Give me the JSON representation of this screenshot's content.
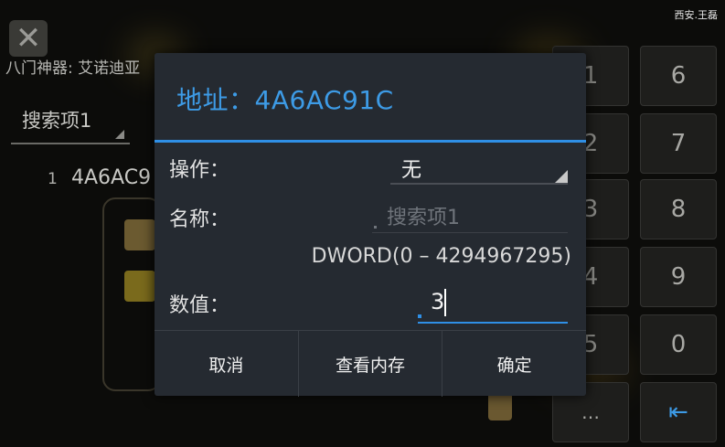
{
  "watermark": "西安.王磊",
  "background": {
    "app_title": "八门神器: 艾诺迪亚",
    "search_item_label": "搜索项1",
    "result_index": "1",
    "result_value": "4A6AC9",
    "keypad_keys": [
      "1",
      "6",
      "2",
      "7",
      "3",
      "8",
      "4",
      "9",
      "5",
      "0",
      "…",
      "⇤"
    ]
  },
  "dialog": {
    "title": "地址：4A6AC91C",
    "operation_label": "操作：",
    "operation_value": "无",
    "name_label": "名称：",
    "name_placeholder": "搜索项1",
    "range_text": "DWORD(0 – 4294967295)",
    "value_label": "数值：",
    "value": "3",
    "buttons": {
      "cancel": "取消",
      "view_memory": "查看内存",
      "ok": "确定"
    }
  },
  "colors": {
    "accent": "#2f8fe6",
    "dialog_bg": "#252a31"
  }
}
